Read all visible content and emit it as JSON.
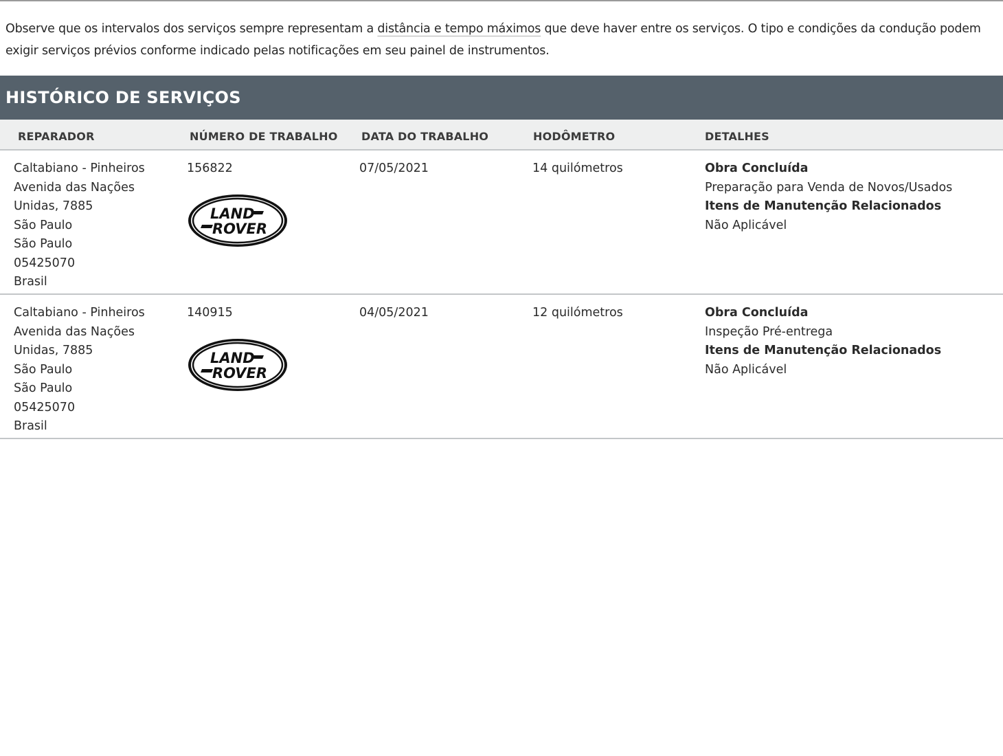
{
  "intro": {
    "before": "Observe que os intervalos dos serviços sempre representam a ",
    "link": "distância e tempo máximos",
    "after": " que deve haver entre os serviços. O tipo e condições da condução podem exigir serviços prévios conforme indicado pelas notificações em seu painel de instrumentos."
  },
  "section_title": "HISTÓRICO DE SERVIÇOS",
  "columns": [
    "REPARADOR",
    "NÚMERO DE TRABALHO",
    "DATA DO TRABALHO",
    "HODÔMETRO",
    "DETALHES"
  ],
  "logo": {
    "line1": "LAND",
    "line2": "ROVER"
  },
  "rows": [
    {
      "repairer": [
        "Caltabiano - Pinheiros",
        "Avenida das Nações",
        "Unidas, 7885",
        "São Paulo",
        "São Paulo",
        "05425070",
        "Brasil"
      ],
      "job_number": "156822",
      "job_date": "07/05/2021",
      "odometer": "14 quilómetros",
      "details": {
        "status_label": "Obra Concluída",
        "status_value": "Preparação para Venda de Novos/Usados",
        "items_label": "Itens de Manutenção Relacionados",
        "items_value": "Não Aplicável"
      }
    },
    {
      "repairer": [
        "Caltabiano - Pinheiros",
        "Avenida das Nações",
        "Unidas, 7885",
        "São Paulo",
        "São Paulo",
        "05425070",
        "Brasil"
      ],
      "job_number": "140915",
      "job_date": "04/05/2021",
      "odometer": "12 quilómetros",
      "details": {
        "status_label": "Obra Concluída",
        "status_value": "Inspeção Pré-entrega",
        "items_label": "Itens de Manutenção Relacionados",
        "items_value": "Não Aplicável"
      }
    }
  ]
}
